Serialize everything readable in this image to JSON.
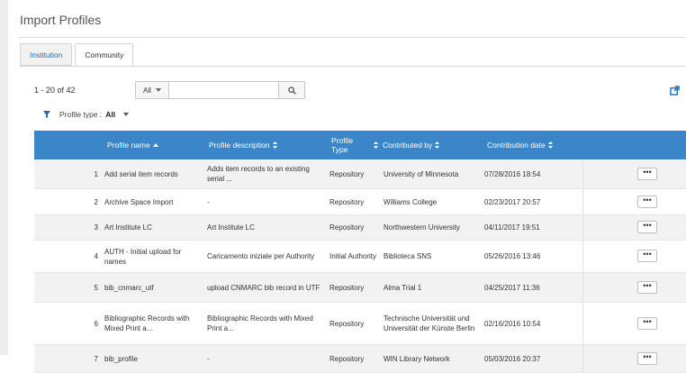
{
  "page": {
    "title": "Import Profiles"
  },
  "tabs": [
    {
      "label": "Institution",
      "active": false
    },
    {
      "label": "Community",
      "active": true
    }
  ],
  "toolbar": {
    "count": "1 - 20 of 42",
    "scope_select": "All",
    "search_value": ""
  },
  "facet": {
    "label": "Profile type :",
    "value": "All"
  },
  "table": {
    "headers": {
      "name": "Profile name",
      "description": "Profile description",
      "type_line1": "Profile",
      "type_line2": "Type",
      "contributed_by": "Contributed by",
      "date": "Contribution date"
    },
    "rows": [
      {
        "index": "1",
        "name": "Add serial item records",
        "description": "Adds item records to an existing serial ...",
        "type": "Repository",
        "contributed_by": "University of Minnesota",
        "date": "07/28/2016 18:54",
        "action": "•••"
      },
      {
        "index": "2",
        "name": "Archive Space Import",
        "description": "-",
        "type": "Repository",
        "contributed_by": "Williams College",
        "date": "02/23/2017 20:57",
        "action": "•••"
      },
      {
        "index": "3",
        "name": "Art Institute LC",
        "description": "Art Institute LC",
        "type": "Repository",
        "contributed_by": "Northwestern University",
        "date": "04/11/2017 19:51",
        "action": "•••"
      },
      {
        "index": "4",
        "name": "AUTH - Initial upload for names",
        "description": "Caricamento iniziale per Authority",
        "type": "Initial Authority",
        "contributed_by": "Biblioteca SNS",
        "date": "05/26/2016 13:46",
        "action": "•••"
      },
      {
        "index": "5",
        "name": "bib_cnmarc_utf",
        "description": "upload CNMARC bib record in UTF",
        "type": "Repository",
        "contributed_by": "Alma Trial 1",
        "date": "04/25/2017 11:36",
        "action": "•••"
      },
      {
        "index": "6",
        "name": "Bibliographic Records with Mixed Print a...",
        "description": "Bibliographic Records with Mixed Print a...",
        "type": "Repository",
        "contributed_by": "Technische Universität und Universität der Künste Berlin",
        "date": "02/16/2016 10:54",
        "action": "•••"
      },
      {
        "index": "7",
        "name": "bib_profile",
        "description": "-",
        "type": "Repository",
        "contributed_by": "WIN Library Network",
        "date": "05/03/2016 20:37",
        "action": "•••"
      }
    ]
  },
  "colors": {
    "header_bg": "#3a86c8",
    "accent": "#1e6db3",
    "odd_row": "#f2f2f2"
  }
}
